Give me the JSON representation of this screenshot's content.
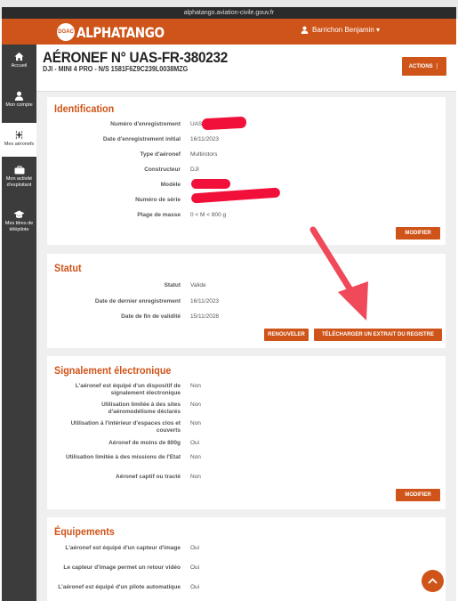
{
  "browser": {
    "url": "alphatango.aviation-civile.gouv.fr"
  },
  "app": {
    "logo_badge": "DGAC",
    "logo_text": "ALPHATANGO",
    "user_name": "Barrichon Benjamin ▾"
  },
  "sidebar": {
    "items": [
      {
        "label": "Accueil",
        "icon": "home-icon"
      },
      {
        "label": "Mon compte",
        "icon": "user-icon"
      },
      {
        "label": "Mes aéronefs",
        "icon": "drone-icon"
      },
      {
        "label": "Mon activité d'exploitant",
        "icon": "briefcase-icon"
      },
      {
        "label": "Mes titres de télépilote",
        "icon": "graduation-cap-icon"
      }
    ]
  },
  "header": {
    "title": "AÉRONEF N° UAS-FR-380232",
    "subtitle": "DJI - MINI 4 PRO - N/S 1581F6Z9C239L0038MZG",
    "actions_label": "ACTIONS ⋮"
  },
  "identification": {
    "title": "Identification",
    "rows": [
      {
        "label": "Numéro d'enregistrement",
        "value": "UAS-F"
      },
      {
        "label": "Date d'enregistrement initial",
        "value": "16/11/2023"
      },
      {
        "label": "Type d'aéronef",
        "value": "Multirotors"
      },
      {
        "label": "Constructeur",
        "value": "DJI"
      },
      {
        "label": "Modèle",
        "value": "o"
      },
      {
        "label": "Numéro de série",
        "value": ""
      },
      {
        "label": "Plage de masse",
        "value": "0 < M < 800 g"
      }
    ],
    "modify_label": "MODIFIER"
  },
  "statut": {
    "title": "Statut",
    "rows": [
      {
        "label": "Statut",
        "value": "Valide"
      },
      {
        "label": "Date de dernier enregistrement",
        "value": "16/11/2023"
      },
      {
        "label": "Date de fin de validité",
        "value": "15/11/2028"
      }
    ],
    "renew_label": "RENOUVELER",
    "download_label": "TÉLÉCHARGER UN EXTRAIT DU REGISTRE"
  },
  "signalement": {
    "title": "Signalement électronique",
    "rows": [
      {
        "label": "L'aéronef est équipé d'un dispositif de signalement électronique",
        "value": "Non"
      },
      {
        "label": "Utilisation limitée à des sites d'aéromodélisme déclarés",
        "value": "Non"
      },
      {
        "label": "Utilisation à l'intérieur d'espaces clos et couverts",
        "value": "Non"
      },
      {
        "label": "Aéronef de moins de 800g",
        "value": "Oui"
      },
      {
        "label": "Utilisation limitée à des missions de l'Etat",
        "value": "Non"
      },
      {
        "label": "Aéronef captif ou tracté",
        "value": "Non"
      }
    ],
    "modify_label": "MODIFIER"
  },
  "equipements": {
    "title": "Équipements",
    "rows": [
      {
        "label": "L'aéronef est équipé d'un capteur d'image",
        "value": "Oui"
      },
      {
        "label": "Le capteur d'image permet un retour vidéo",
        "value": "Oui"
      },
      {
        "label": "L'aéronef est équipé d'un pilote automatique",
        "value": "Oui"
      }
    ]
  },
  "colors": {
    "brand": "#cf5419",
    "sidebar": "#3c3c3c",
    "annotation_arrow": "#f04a5a",
    "redaction": "#f0103a"
  }
}
